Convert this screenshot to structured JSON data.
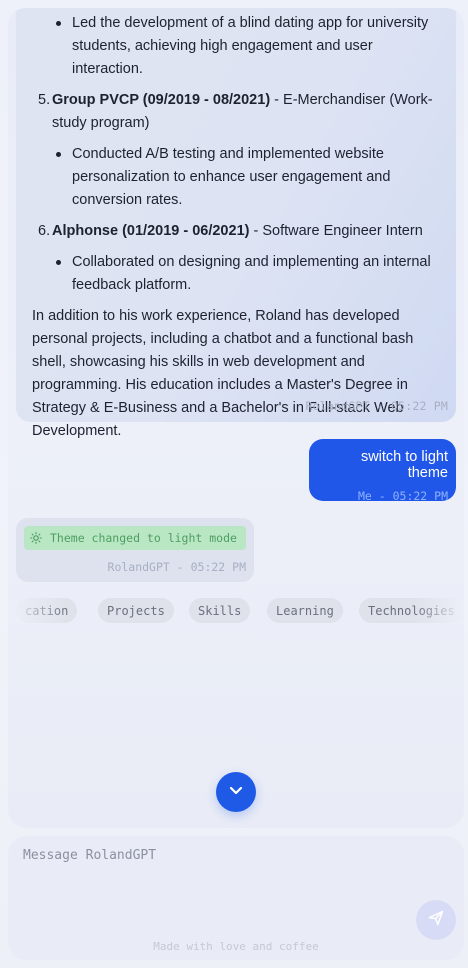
{
  "bot_message": {
    "items": [
      {
        "kind": "bullet",
        "text": "Led the development of a blind dating app for university students, achieving high engagement and user interaction."
      },
      {
        "kind": "numbered",
        "number": "5.",
        "bold": "Group PVCP (09/2019 - 08/2021)",
        "rest": " - E-Merchandiser (Work-study program)"
      },
      {
        "kind": "bullet",
        "text": "Conducted A/B testing and implemented website personalization to enhance user engagement and conversion rates."
      },
      {
        "kind": "numbered",
        "number": "6.",
        "bold": "Alphonse (01/2019 - 06/2021)",
        "rest": " - Software Engineer Intern"
      },
      {
        "kind": "bullet",
        "text": "Collaborated on designing and implementing an internal feedback platform."
      }
    ],
    "summary": "In addition to his work experience, Roland has developed personal projects, including a chatbot and a functional bash shell, showcasing his skills in web development and programming. His education includes a Master's Degree in Strategy & E-Business and a Bachelor's in Full-stack Web Development.",
    "meta": "RolandGPT - 05:22 PM"
  },
  "user_message": {
    "text": "switch to light theme",
    "meta": "Me - 05:22 PM"
  },
  "theme_message": {
    "icon": "sun-icon",
    "chip_text": "Theme changed to light mode",
    "meta": "RolandGPT - 05:22 PM"
  },
  "suggestions": [
    "cation",
    "Projects",
    "Skills",
    "Learning",
    "Technologies"
  ],
  "composer": {
    "placeholder": "Message RolandGPT",
    "value": "",
    "footer": "Made with love and coffee"
  },
  "colors": {
    "accent": "#2157e8",
    "success_chip_bg": "#b9e7c4",
    "success_chip_text": "#4f9e62"
  }
}
